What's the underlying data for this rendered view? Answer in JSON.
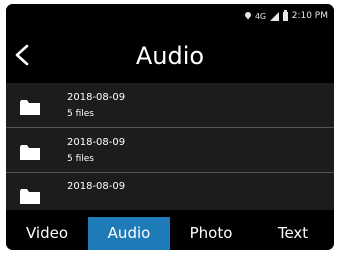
{
  "status": {
    "network": "4G",
    "time": "2:10 PM",
    "icons": [
      "location-icon",
      "signal-icon",
      "battery-icon"
    ]
  },
  "header": {
    "title": "Audio",
    "back_icon": "chevron-left-icon"
  },
  "list": {
    "items": [
      {
        "date": "2018-08-09",
        "count": "5 files"
      },
      {
        "date": "2018-08-09",
        "count": "5 files"
      },
      {
        "date": "2018-08-09",
        "count": ""
      }
    ]
  },
  "tabs": [
    {
      "label": "Video",
      "active": false
    },
    {
      "label": "Audio",
      "active": true
    },
    {
      "label": "Photo",
      "active": false
    },
    {
      "label": "Text",
      "active": false
    }
  ],
  "colors": {
    "background": "#000000",
    "list_background": "#1c1c1c",
    "active_tab": "#1f7bb8"
  }
}
